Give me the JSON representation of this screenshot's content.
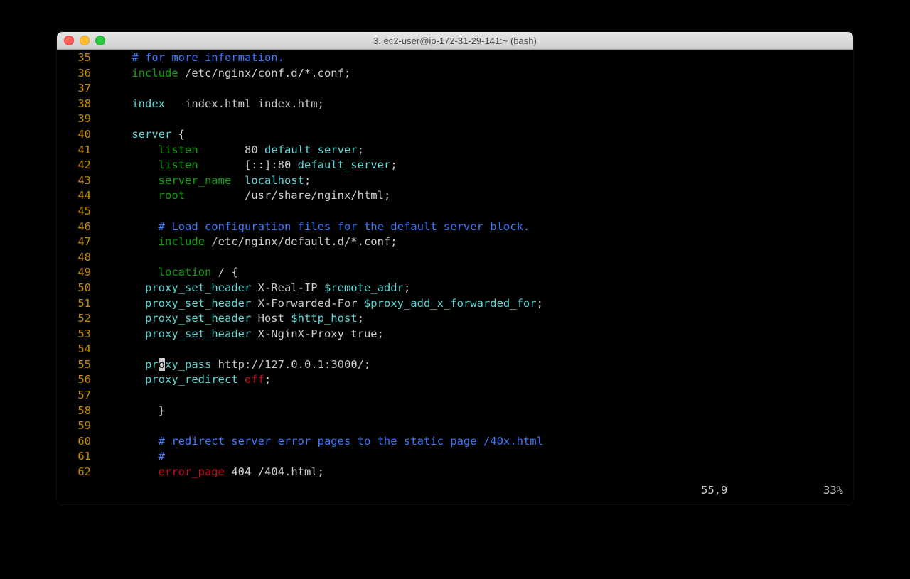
{
  "window": {
    "title": "3. ec2-user@ip-172-31-29-141:~ (bash)"
  },
  "status": {
    "position": "55,9",
    "percent": "33%"
  },
  "editor": {
    "cursor_char": "o",
    "lines": [
      {
        "n": "35",
        "tokens": [
          {
            "t": "    ",
            "c": "c-white"
          },
          {
            "t": "# for more information.",
            "c": "c-blue"
          }
        ]
      },
      {
        "n": "36",
        "tokens": [
          {
            "t": "    ",
            "c": "c-white"
          },
          {
            "t": "include",
            "c": "c-green"
          },
          {
            "t": " /etc/nginx/conf.d/*.conf;",
            "c": "c-white"
          }
        ]
      },
      {
        "n": "37",
        "tokens": []
      },
      {
        "n": "38",
        "tokens": [
          {
            "t": "    ",
            "c": "c-white"
          },
          {
            "t": "index",
            "c": "c-cyan"
          },
          {
            "t": "   index.html index.htm;",
            "c": "c-white"
          }
        ]
      },
      {
        "n": "39",
        "tokens": []
      },
      {
        "n": "40",
        "tokens": [
          {
            "t": "    ",
            "c": "c-white"
          },
          {
            "t": "server",
            "c": "c-cyan"
          },
          {
            "t": " {",
            "c": "c-white"
          }
        ]
      },
      {
        "n": "41",
        "tokens": [
          {
            "t": "        ",
            "c": "c-white"
          },
          {
            "t": "listen",
            "c": "c-green"
          },
          {
            "t": "       ",
            "c": "c-white"
          },
          {
            "t": "80",
            "c": "c-white"
          },
          {
            "t": " ",
            "c": "c-white"
          },
          {
            "t": "default_server",
            "c": "c-cyan"
          },
          {
            "t": ";",
            "c": "c-white"
          }
        ]
      },
      {
        "n": "42",
        "tokens": [
          {
            "t": "        ",
            "c": "c-white"
          },
          {
            "t": "listen",
            "c": "c-green"
          },
          {
            "t": "       [::]:",
            "c": "c-white"
          },
          {
            "t": "80",
            "c": "c-white"
          },
          {
            "t": " ",
            "c": "c-white"
          },
          {
            "t": "default_server",
            "c": "c-cyan"
          },
          {
            "t": ";",
            "c": "c-white"
          }
        ]
      },
      {
        "n": "43",
        "tokens": [
          {
            "t": "        ",
            "c": "c-white"
          },
          {
            "t": "server_name",
            "c": "c-green"
          },
          {
            "t": "  ",
            "c": "c-white"
          },
          {
            "t": "localhost",
            "c": "c-cyan"
          },
          {
            "t": ";",
            "c": "c-white"
          }
        ]
      },
      {
        "n": "44",
        "tokens": [
          {
            "t": "        ",
            "c": "c-white"
          },
          {
            "t": "root",
            "c": "c-green"
          },
          {
            "t": "         /usr/share/nginx/html;",
            "c": "c-white"
          }
        ]
      },
      {
        "n": "45",
        "tokens": []
      },
      {
        "n": "46",
        "tokens": [
          {
            "t": "        ",
            "c": "c-white"
          },
          {
            "t": "# Load configuration files for the default server block.",
            "c": "c-blue"
          }
        ]
      },
      {
        "n": "47",
        "tokens": [
          {
            "t": "        ",
            "c": "c-white"
          },
          {
            "t": "include",
            "c": "c-green"
          },
          {
            "t": " /etc/nginx/default.d/*.conf;",
            "c": "c-white"
          }
        ]
      },
      {
        "n": "48",
        "tokens": []
      },
      {
        "n": "49",
        "tokens": [
          {
            "t": "        ",
            "c": "c-white"
          },
          {
            "t": "location",
            "c": "c-green"
          },
          {
            "t": " ",
            "c": "c-white"
          },
          {
            "t": "/ ",
            "c": "c-white"
          },
          {
            "t": "{",
            "c": "c-white"
          }
        ]
      },
      {
        "n": "50",
        "tokens": [
          {
            "t": "      ",
            "c": "c-white"
          },
          {
            "t": "proxy_set_header",
            "c": "c-cyan"
          },
          {
            "t": " X-Real-IP ",
            "c": "c-white"
          },
          {
            "t": "$remote_addr",
            "c": "c-cyan"
          },
          {
            "t": ";",
            "c": "c-white"
          }
        ]
      },
      {
        "n": "51",
        "tokens": [
          {
            "t": "      ",
            "c": "c-white"
          },
          {
            "t": "proxy_set_header",
            "c": "c-cyan"
          },
          {
            "t": " X-Forwarded-For ",
            "c": "c-white"
          },
          {
            "t": "$proxy_add_x_forwarded_for",
            "c": "c-cyan"
          },
          {
            "t": ";",
            "c": "c-white"
          }
        ]
      },
      {
        "n": "52",
        "tokens": [
          {
            "t": "      ",
            "c": "c-white"
          },
          {
            "t": "proxy_set_header",
            "c": "c-cyan"
          },
          {
            "t": " Host ",
            "c": "c-white"
          },
          {
            "t": "$http_host",
            "c": "c-cyan"
          },
          {
            "t": ";",
            "c": "c-white"
          }
        ]
      },
      {
        "n": "53",
        "tokens": [
          {
            "t": "      ",
            "c": "c-white"
          },
          {
            "t": "proxy_set_header",
            "c": "c-cyan"
          },
          {
            "t": " X-NginX-Proxy true;",
            "c": "c-white"
          }
        ]
      },
      {
        "n": "54",
        "tokens": []
      },
      {
        "n": "55",
        "tokens": [
          {
            "t": "      ",
            "c": "c-white"
          },
          {
            "t": "pr",
            "c": "c-cyan"
          },
          {
            "cursor": true
          },
          {
            "t": "xy_pass",
            "c": "c-cyan"
          },
          {
            "t": " http://",
            "c": "c-white"
          },
          {
            "t": "127.0.0.1:3000",
            "c": "c-white"
          },
          {
            "t": "/;",
            "c": "c-white"
          }
        ]
      },
      {
        "n": "56",
        "tokens": [
          {
            "t": "      ",
            "c": "c-white"
          },
          {
            "t": "proxy_redirect",
            "c": "c-cyan"
          },
          {
            "t": " ",
            "c": "c-white"
          },
          {
            "t": "off",
            "c": "c-red"
          },
          {
            "t": ";",
            "c": "c-white"
          }
        ]
      },
      {
        "n": "57",
        "tokens": []
      },
      {
        "n": "58",
        "tokens": [
          {
            "t": "        }",
            "c": "c-white"
          }
        ]
      },
      {
        "n": "59",
        "tokens": []
      },
      {
        "n": "60",
        "tokens": [
          {
            "t": "        ",
            "c": "c-white"
          },
          {
            "t": "# redirect server error pages to the static page /40x.html",
            "c": "c-blue"
          }
        ]
      },
      {
        "n": "61",
        "tokens": [
          {
            "t": "        ",
            "c": "c-white"
          },
          {
            "t": "#",
            "c": "c-blue"
          }
        ]
      },
      {
        "n": "62",
        "tokens": [
          {
            "t": "        ",
            "c": "c-white"
          },
          {
            "t": "error_page",
            "c": "c-red"
          },
          {
            "t": " ",
            "c": "c-white"
          },
          {
            "t": "404",
            "c": "c-white"
          },
          {
            "t": " /404.html;",
            "c": "c-white"
          }
        ]
      }
    ]
  }
}
